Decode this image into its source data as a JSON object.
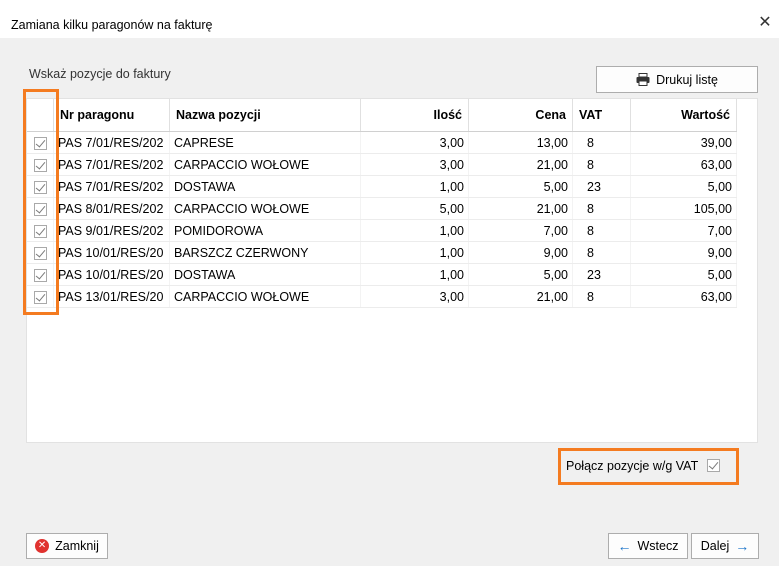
{
  "window": {
    "title": "Zamiana kilku paragonów na fakturę",
    "close_glyph": "✕"
  },
  "section_label": "Wskaż pozycje do faktury",
  "print_button": {
    "label": "Drukuj listę",
    "icon": "printer-icon"
  },
  "table": {
    "columns": {
      "nr": "Nr paragonu",
      "name": "Nazwa pozycji",
      "qty": "Ilość",
      "price": "Cena",
      "vat": "VAT",
      "value": "Wartość"
    },
    "rows": [
      {
        "checked": true,
        "nr": "PAS 7/01/RES/202",
        "name": "CAPRESE",
        "qty": "3,00",
        "price": "13,00",
        "vat": "8",
        "value": "39,00"
      },
      {
        "checked": true,
        "nr": "PAS 7/01/RES/202",
        "name": "CARPACCIO WOŁOWE",
        "qty": "3,00",
        "price": "21,00",
        "vat": "8",
        "value": "63,00"
      },
      {
        "checked": true,
        "nr": "PAS 7/01/RES/202",
        "name": "DOSTAWA",
        "qty": "1,00",
        "price": "5,00",
        "vat": "23",
        "value": "5,00"
      },
      {
        "checked": true,
        "nr": "PAS 8/01/RES/202",
        "name": "CARPACCIO WOŁOWE",
        "qty": "5,00",
        "price": "21,00",
        "vat": "8",
        "value": "105,00"
      },
      {
        "checked": true,
        "nr": "PAS 9/01/RES/202",
        "name": "POMIDOROWA",
        "qty": "1,00",
        "price": "7,00",
        "vat": "8",
        "value": "7,00"
      },
      {
        "checked": true,
        "nr": "PAS 10/01/RES/20",
        "name": "BARSZCZ CZERWONY",
        "qty": "1,00",
        "price": "9,00",
        "vat": "8",
        "value": "9,00"
      },
      {
        "checked": true,
        "nr": "PAS 10/01/RES/20",
        "name": "DOSTAWA",
        "qty": "1,00",
        "price": "5,00",
        "vat": "23",
        "value": "5,00"
      },
      {
        "checked": true,
        "nr": "PAS 13/01/RES/20",
        "name": "CARPACCIO WOŁOWE",
        "qty": "3,00",
        "price": "21,00",
        "vat": "8",
        "value": "63,00"
      }
    ]
  },
  "merge_vat": {
    "label": "Połącz pozycje w/g VAT",
    "checked": true
  },
  "buttons": {
    "close": "Zamknij",
    "back": "Wstecz",
    "next": "Dalej"
  },
  "colors": {
    "highlight": "#f47b20",
    "close_icon": "#e0322f",
    "arrow": "#1a73c9"
  }
}
